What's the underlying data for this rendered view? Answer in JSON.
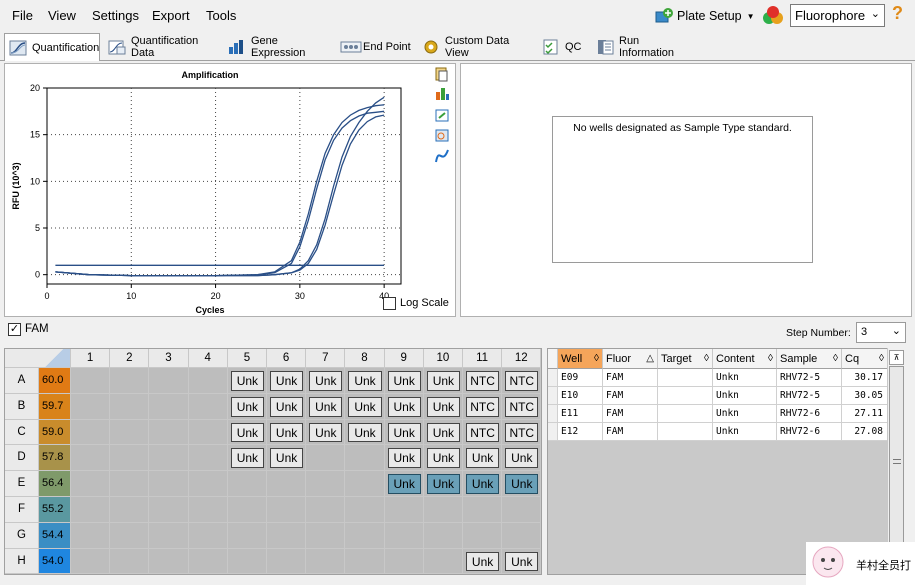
{
  "menu": {
    "file": "File",
    "view": "View",
    "settings": "Settings",
    "export": "Export",
    "tools": "Tools"
  },
  "toolbar": {
    "plate_setup": "Plate Setup",
    "fluorophore": "Fluorophore",
    "help": "?"
  },
  "tabs": [
    "Quantification",
    "Quantification Data",
    "Gene Expression",
    "End Point",
    "Custom Data View",
    "QC",
    "Run Information"
  ],
  "chart": {
    "title": "Amplification",
    "xlabel": "Cycles",
    "ylabel": "RFU (10^3)",
    "log_scale_label": "Log Scale"
  },
  "chart_data": {
    "type": "line",
    "title": "Amplification",
    "xlabel": "Cycles",
    "ylabel": "RFU (10^3)",
    "xlim": [
      0,
      42
    ],
    "ylim": [
      -1,
      20
    ],
    "x_ticks": [
      0,
      10,
      20,
      30,
      40
    ],
    "y_ticks": [
      0,
      5,
      10,
      15,
      20
    ],
    "grid": true,
    "x": [
      1,
      5,
      10,
      15,
      20,
      25,
      27,
      29,
      30,
      31,
      32,
      33,
      34,
      35,
      36,
      37,
      38,
      39,
      40
    ],
    "series": [
      {
        "values": [
          0.3,
          0.0,
          -0.1,
          -0.1,
          -0.1,
          0.0,
          0.3,
          1.5,
          3.5,
          6.5,
          10.0,
          13.0,
          15.0,
          16.3,
          17.1,
          17.6,
          17.9,
          18.1,
          18.2
        ]
      },
      {
        "values": [
          0.3,
          0.0,
          -0.1,
          -0.1,
          -0.1,
          0.0,
          0.2,
          1.2,
          3.0,
          5.8,
          9.2,
          12.3,
          14.4,
          15.7,
          16.5,
          17.0,
          17.3,
          17.4,
          17.5
        ]
      },
      {
        "values": [
          0.3,
          0.0,
          -0.1,
          -0.1,
          -0.1,
          -0.1,
          0.0,
          0.2,
          0.6,
          1.5,
          3.2,
          6.0,
          9.5,
          12.6,
          14.8,
          16.3,
          17.5,
          18.4,
          19.0
        ]
      },
      {
        "values": [
          0.3,
          0.0,
          -0.1,
          -0.1,
          -0.1,
          -0.1,
          0.0,
          0.2,
          0.5,
          1.2,
          2.7,
          5.3,
          8.6,
          11.7,
          14.0,
          15.5,
          16.4,
          16.9,
          17.1
        ]
      },
      {
        "values": [
          1.0,
          1.0,
          1.0,
          1.0,
          1.0,
          1.0,
          1.0,
          1.0,
          1.0,
          1.0,
          1.0,
          1.0,
          1.0,
          1.0,
          1.0,
          1.0,
          1.0,
          1.0,
          1.0
        ]
      }
    ],
    "series_color": "#2a4f87"
  },
  "standard": {
    "message": "No wells designated as Sample Type standard."
  },
  "fam": {
    "label": "FAM",
    "step_label": "Step Number:",
    "step_value": "3"
  },
  "plate": {
    "cols": [
      "1",
      "2",
      "3",
      "4",
      "5",
      "6",
      "7",
      "8",
      "9",
      "10",
      "11",
      "12"
    ],
    "rows": [
      {
        "label": "A",
        "temp": "60.0",
        "color": "#e07a14",
        "wells": [
          "",
          "",
          "",
          "",
          "Unk",
          "Unk",
          "Unk",
          "Unk",
          "Unk",
          "Unk",
          "NTC",
          "NTC"
        ]
      },
      {
        "label": "B",
        "temp": "59.7",
        "color": "#d9831a",
        "wells": [
          "",
          "",
          "",
          "",
          "Unk",
          "Unk",
          "Unk",
          "Unk",
          "Unk",
          "Unk",
          "NTC",
          "NTC"
        ]
      },
      {
        "label": "C",
        "temp": "59.0",
        "color": "#c98c2c",
        "wells": [
          "",
          "",
          "",
          "",
          "Unk",
          "Unk",
          "Unk",
          "Unk",
          "Unk",
          "Unk",
          "NTC",
          "NTC"
        ]
      },
      {
        "label": "D",
        "temp": "57.8",
        "color": "#a8924a",
        "wells": [
          "",
          "",
          "",
          "",
          "Unk",
          "Unk",
          "",
          "",
          "Unk",
          "Unk",
          "Unk",
          "Unk"
        ]
      },
      {
        "label": "E",
        "temp": "56.4",
        "color": "#7f9a6a",
        "wells": [
          "",
          "",
          "",
          "",
          "",
          "",
          "",
          "",
          "Unk*",
          "Unk*",
          "Unk*",
          "Unk*"
        ]
      },
      {
        "label": "F",
        "temp": "55.2",
        "color": "#5a98a0",
        "wells": [
          "",
          "",
          "",
          "",
          "",
          "",
          "",
          "",
          "",
          "",
          "",
          ""
        ]
      },
      {
        "label": "G",
        "temp": "54.4",
        "color": "#3a8ec4",
        "wells": [
          "",
          "",
          "",
          "",
          "",
          "",
          "",
          "",
          "",
          "",
          "",
          ""
        ]
      },
      {
        "label": "H",
        "temp": "54.0",
        "color": "#1f86e0",
        "wells": [
          "",
          "",
          "",
          "",
          "",
          "",
          "",
          "",
          "",
          "",
          "Unk",
          "Unk"
        ]
      }
    ]
  },
  "well_table": {
    "headers": [
      "Well",
      "Fluor",
      "Target",
      "Content",
      "Sample",
      "Cq"
    ],
    "rows": [
      [
        "E09",
        "FAM",
        "",
        "Unkn",
        "RHV72-5",
        "30.17"
      ],
      [
        "E10",
        "FAM",
        "",
        "Unkn",
        "RHV72-5",
        "30.05"
      ],
      [
        "E11",
        "FAM",
        "",
        "Unkn",
        "RHV72-6",
        "27.11"
      ],
      [
        "E12",
        "FAM",
        "",
        "Unkn",
        "RHV72-6",
        "27.08"
      ]
    ]
  },
  "watermark": {
    "text": "羊村全员打"
  }
}
